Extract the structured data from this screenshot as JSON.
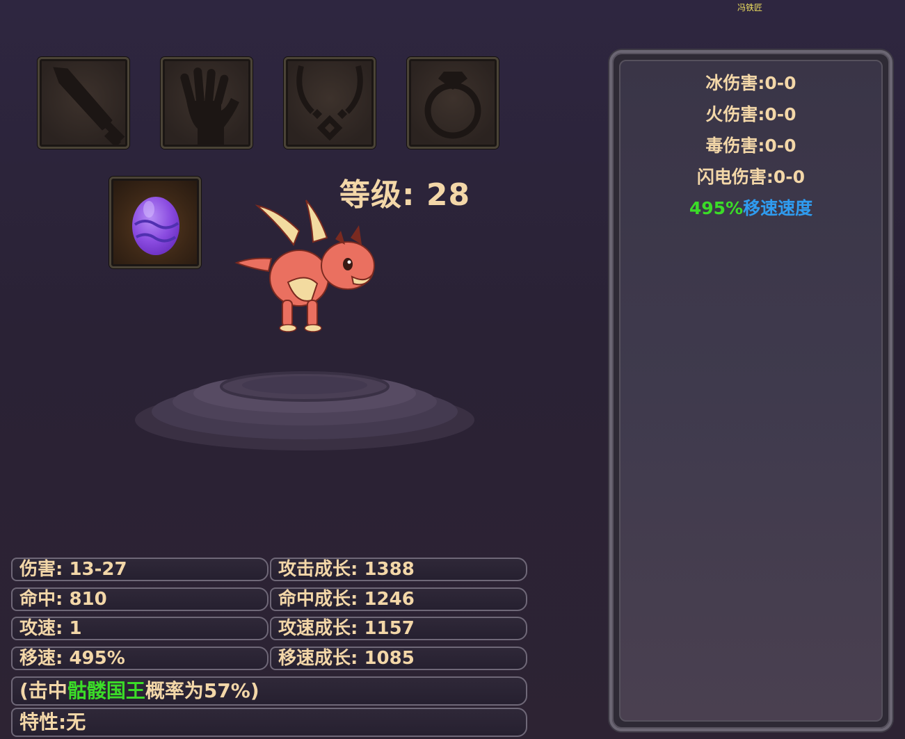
{
  "npc_label": "冯铁匠",
  "equipment_slots": [
    {
      "icon": "sword-icon"
    },
    {
      "icon": "glove-icon"
    },
    {
      "icon": "necklace-icon"
    },
    {
      "icon": "ring-icon"
    }
  ],
  "pet_slot": {
    "icon": "dragon-egg-icon"
  },
  "level_text": "等级: 28",
  "stats": {
    "damage": "伤害:  13-27",
    "attack_growth": "攻击成长: 1388",
    "hit": "命中: 810",
    "hit_growth": "命中成长: 1246",
    "attack_speed": "攻速: 1",
    "attack_speed_growth": "攻速成长: 1157",
    "move_speed": "移速: 495%",
    "move_speed_growth": "移速成长: 1085",
    "effect_prefix": "(击中",
    "effect_target": "骷髅国王",
    "effect_suffix": "概率为57%)",
    "trait": "特性:无"
  },
  "side_panel": {
    "ice_damage": "冰伤害:0-0",
    "fire_damage": "火伤害:0-0",
    "poison_damage": "毒伤害:0-0",
    "lightning_damage": "闪电伤害:0-0",
    "move_bonus_value": "495%",
    "move_bonus_label": "移速速度"
  },
  "colors": {
    "text": "#f3d7a8",
    "highlight_green": "#3bdc28",
    "highlight_blue": "#2f9cf0"
  }
}
